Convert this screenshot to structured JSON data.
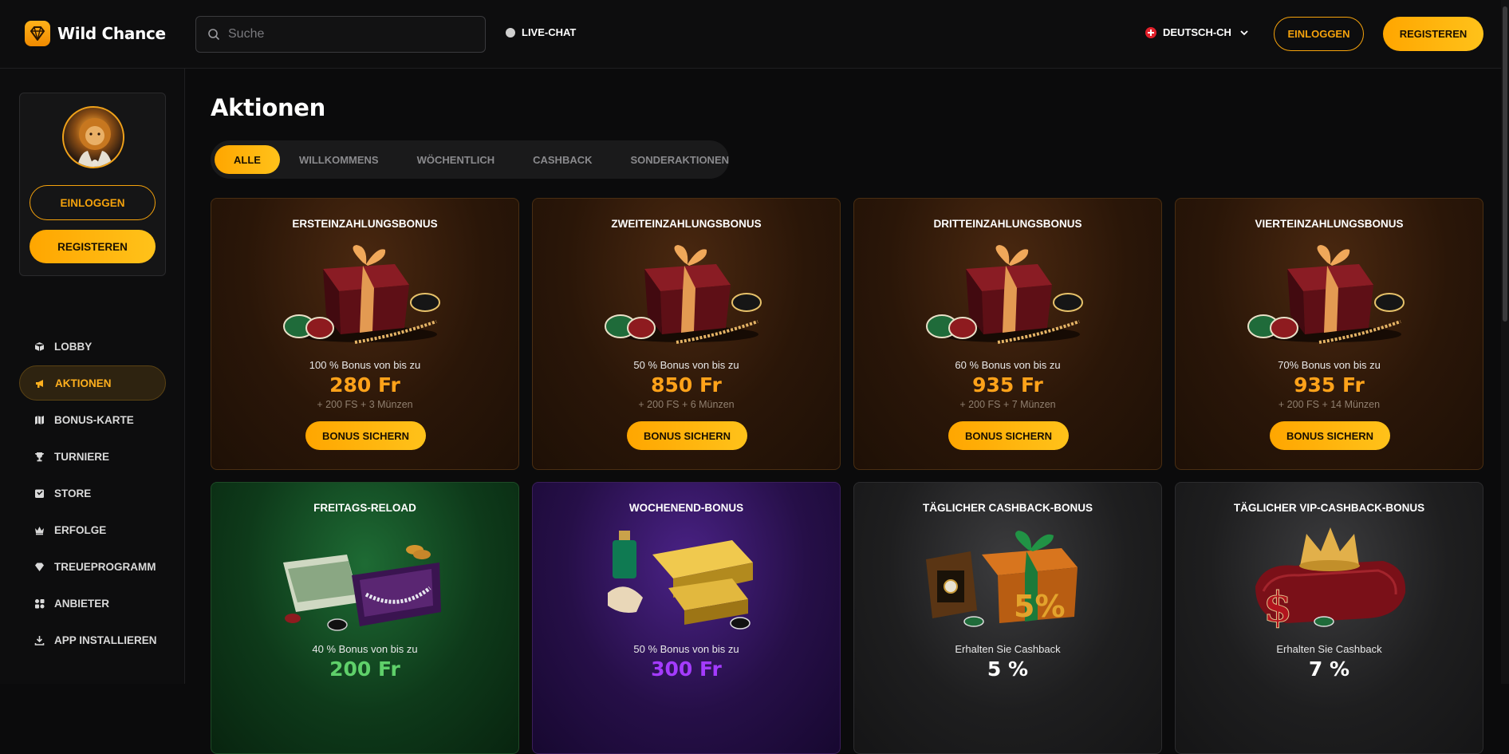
{
  "header": {
    "brand": "Wild Chance",
    "search_placeholder": "Suche",
    "live_chat": "LIVE-CHAT",
    "language": "DEUTSCH-CH",
    "login": "EINLOGGEN",
    "register": "REGISTEREN"
  },
  "sidebar": {
    "login": "EINLOGGEN",
    "register": "REGISTEREN",
    "items": [
      {
        "label": "LOBBY",
        "icon": "cube-icon"
      },
      {
        "label": "AKTIONEN",
        "icon": "megaphone-icon",
        "active": true
      },
      {
        "label": "BONUS-KARTE",
        "icon": "map-icon"
      },
      {
        "label": "TURNIERE",
        "icon": "trophy-icon"
      },
      {
        "label": "STORE",
        "icon": "store-icon"
      },
      {
        "label": "ERFOLGE",
        "icon": "crown-icon"
      },
      {
        "label": "TREUEPROGRAMM",
        "icon": "diamond-icon"
      },
      {
        "label": "ANBIETER",
        "icon": "grid-icon"
      },
      {
        "label": "APP INSTALLIEREN",
        "icon": "download-icon"
      }
    ]
  },
  "main": {
    "title": "Aktionen",
    "tabs": [
      {
        "label": "ALLE",
        "active": true
      },
      {
        "label": "WILLKOMMENS"
      },
      {
        "label": "WÖCHENTLICH"
      },
      {
        "label": "CASHBACK"
      },
      {
        "label": "SONDERAKTIONEN"
      }
    ],
    "cards": [
      {
        "title": "ERSTEINZAHLUNGSBONUS",
        "sub": "100 % Bonus von bis zu",
        "amount": "280 Fr",
        "extra": "+ 200 FS + 3 Münzen",
        "button": "BONUS SICHERN",
        "theme": "brown",
        "accent": "#ffa21a"
      },
      {
        "title": "ZWEITEINZAHLUNGSBONUS",
        "sub": "50 % Bonus von bis zu",
        "amount": "850 Fr",
        "extra": "+ 200 FS + 6 Münzen",
        "button": "BONUS SICHERN",
        "theme": "brown",
        "accent": "#ffa21a"
      },
      {
        "title": "DRITTEINZAHLUNGSBONUS",
        "sub": "60 % Bonus von bis zu",
        "amount": "935 Fr",
        "extra": "+ 200 FS + 7 Münzen",
        "button": "BONUS SICHERN",
        "theme": "brown",
        "accent": "#ffa21a"
      },
      {
        "title": "VIERTEINZAHLUNGSBONUS",
        "sub": "70% Bonus von bis zu",
        "amount": "935 Fr",
        "extra": "+ 200 FS + 14 Münzen",
        "button": "BONUS SICHERN",
        "theme": "brown",
        "accent": "#ffa21a"
      },
      {
        "title": "FREITAGS-RELOAD",
        "sub": "40 % Bonus von bis zu",
        "amount": "200 Fr",
        "theme": "green",
        "accent": "#5fd06a"
      },
      {
        "title": "WOCHENEND-BONUS",
        "sub": "50 % Bonus von bis zu",
        "amount": "300 Fr",
        "theme": "purple",
        "accent": "#a43bff"
      },
      {
        "title": "TÄGLICHER CASHBACK-BONUS",
        "sub": "Erhalten Sie Cashback",
        "amount": "5 %",
        "theme": "gray",
        "accent": "#ffffff"
      },
      {
        "title": "TÄGLICHER VIP-CASHBACK-BONUS",
        "sub": "Erhalten Sie Cashback",
        "amount": "7 %",
        "theme": "gray",
        "accent": "#ffffff"
      }
    ]
  },
  "colors": {
    "accent": "#ffa600",
    "background": "#0b0b0c"
  }
}
